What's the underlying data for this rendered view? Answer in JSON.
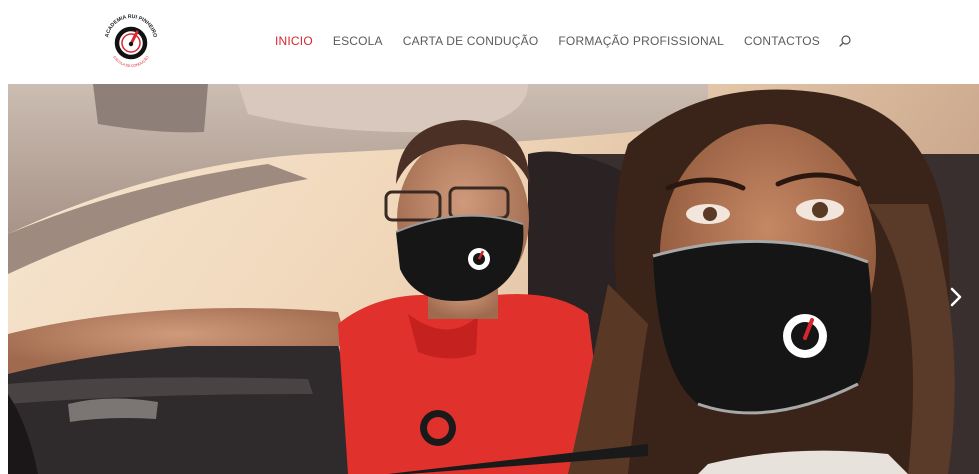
{
  "header": {
    "logo": {
      "icon": "speedometer-logo-icon",
      "text_top": "ACADEMIA RUI PINHEIRO",
      "text_bottom": "ESCOLA DE CONDUÇÃO",
      "colors": {
        "ring": "#111111",
        "accent": "#d9262e"
      }
    },
    "nav": {
      "items": [
        {
          "label": "INICIO",
          "active": true
        },
        {
          "label": "ESCOLA",
          "active": false
        },
        {
          "label": "CARTA DE CONDUÇÃO",
          "active": false
        },
        {
          "label": "FORMAÇÃO PROFISSIONAL",
          "active": false
        },
        {
          "label": "CONTACTOS",
          "active": false
        }
      ],
      "search_icon": "search-icon"
    },
    "colors": {
      "active": "#d9262e",
      "default": "#5b5b5b"
    }
  },
  "hero": {
    "image": "photo-instructor-and-student-in-car-wearing-masks",
    "next_icon": "chevron-right-icon"
  }
}
